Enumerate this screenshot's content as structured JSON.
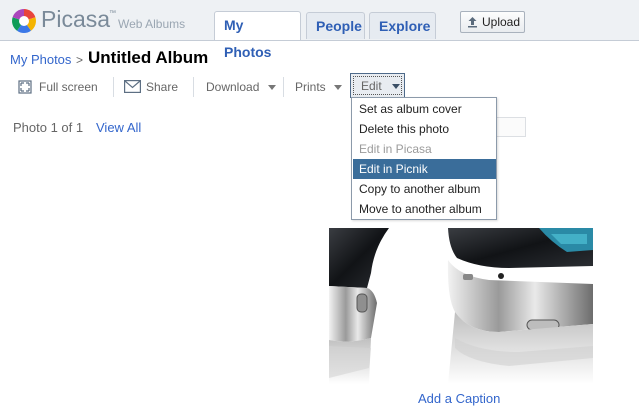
{
  "header": {
    "logo_text": "Picasa",
    "logo_tm": "™",
    "logo_sub": "Web Albums",
    "tabs": [
      {
        "label": "My Photos",
        "active": true
      },
      {
        "label": "People",
        "active": false
      },
      {
        "label": "Explore",
        "active": false
      }
    ],
    "upload_label": "Upload"
  },
  "breadcrumb": {
    "parent": "My Photos",
    "separator": ">",
    "title": "Untitled Album"
  },
  "toolbar": {
    "fullscreen": "Full screen",
    "share": "Share",
    "download": "Download",
    "prints": "Prints",
    "edit": "Edit"
  },
  "edit_menu": {
    "items": [
      {
        "label": "Set as album cover",
        "state": "normal"
      },
      {
        "label": "Delete this photo",
        "state": "normal"
      },
      {
        "label": "Edit in Picasa",
        "state": "disabled"
      },
      {
        "label": "Edit in Picnik",
        "state": "hover"
      },
      {
        "label": "Copy to another album",
        "state": "normal"
      },
      {
        "label": "Move to another album",
        "state": "normal"
      }
    ]
  },
  "content": {
    "photo_counter": "Photo 1 of 1",
    "view_all": "View All",
    "add_caption": "Add a Caption"
  },
  "colors": {
    "link": "#3366cc",
    "menu_highlight": "#3a6d9a",
    "header_bg": "#eef1f4"
  }
}
